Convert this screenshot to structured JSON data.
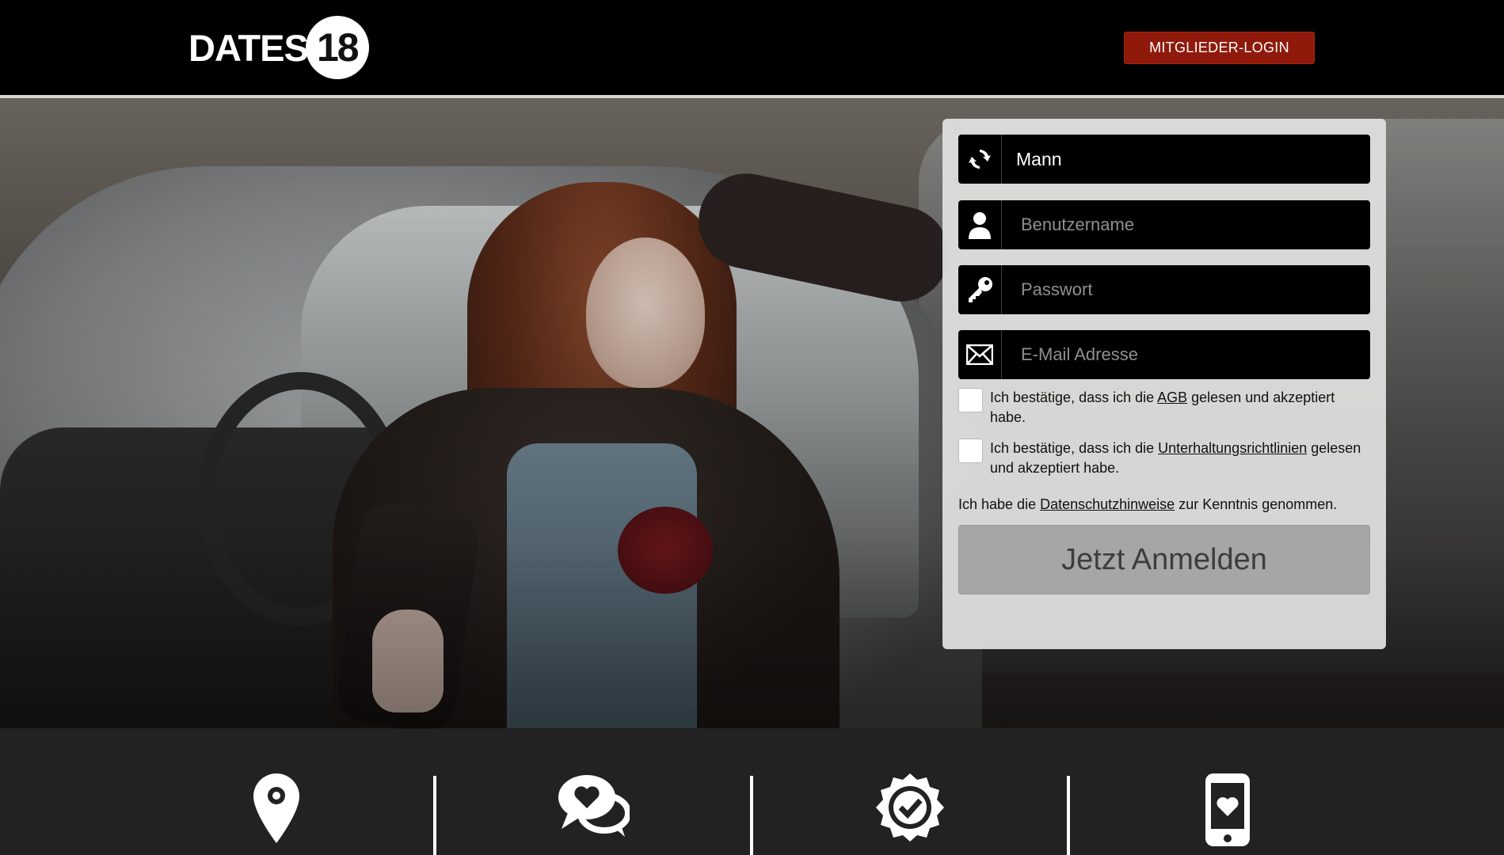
{
  "header": {
    "logo_text": "DATES",
    "logo_number": "18",
    "login_label": "MITGLIEDER-LOGIN"
  },
  "form": {
    "gender_value": "Mann",
    "username_placeholder": "Benutzername",
    "password_placeholder": "Passwort",
    "email_placeholder": "E-Mail Adresse",
    "terms": {
      "prefix": "Ich bestätige, dass ich die ",
      "link": "AGB",
      "suffix": " gelesen und akzeptiert habe."
    },
    "guidelines": {
      "prefix": "Ich bestätige, dass ich die ",
      "link": "Unterhaltungsrichtlinien",
      "suffix": " gelesen und akzeptiert habe."
    },
    "privacy": {
      "prefix": "Ich habe die ",
      "link": "Datenschutzhinweise",
      "suffix": " zur Kenntnis genommen."
    },
    "submit_label": "Jetzt Anmelden"
  },
  "features": [
    {
      "icon": "location-pin-icon"
    },
    {
      "icon": "chat-heart-icon"
    },
    {
      "icon": "verified-badge-icon"
    },
    {
      "icon": "mobile-heart-icon"
    }
  ],
  "colors": {
    "login_button": "#8f1a0b",
    "header_bg": "#000000",
    "form_bg": "#dedede",
    "submit_bg": "#a6a6a6",
    "feature_bar_bg": "#222222"
  }
}
